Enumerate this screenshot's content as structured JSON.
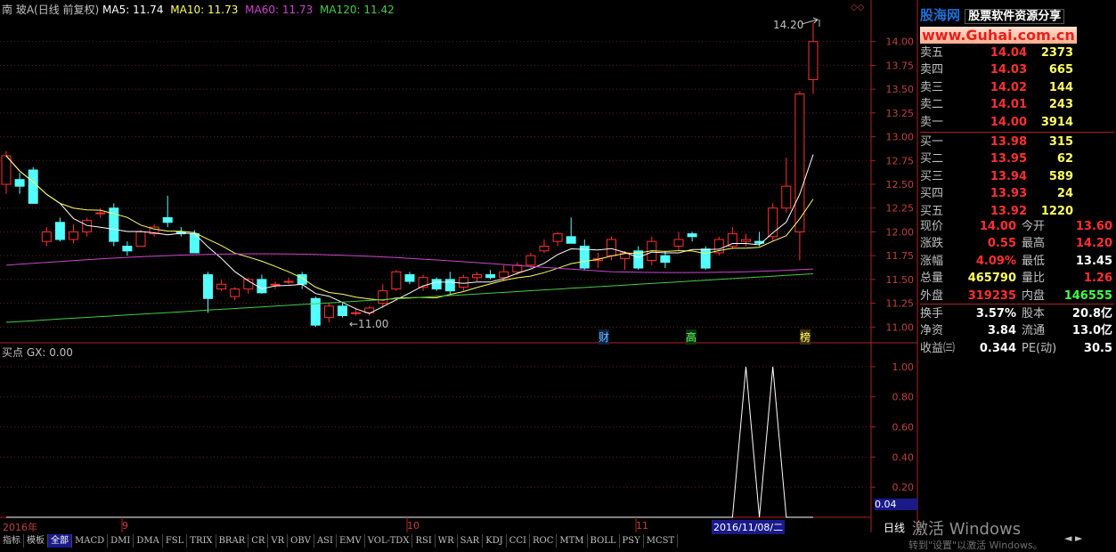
{
  "header": {
    "stock": "南 玻A",
    "mode": "(日线 前复权)",
    "ma5": "MA5: 11.74",
    "ma10": "MA10: 11.73",
    "ma60": "MA60: 11.73",
    "ma120": "MA120: 11.42",
    "ma5_color": "#ffffff",
    "ma10_color": "#ffff66",
    "ma60_color": "#cc44cc",
    "ma120_color": "#44cc44"
  },
  "price_axis": [
    "14.00",
    "13.75",
    "13.50",
    "13.25",
    "13.00",
    "12.75",
    "12.50",
    "12.25",
    "12.00",
    "11.75",
    "11.50",
    "11.25",
    "11.00"
  ],
  "annotations": {
    "high": "14.20",
    "low": "←11.00",
    "event1": "财",
    "event2": "高",
    "event3": "榜"
  },
  "indicator": {
    "title": "买点 GX: 0.00",
    "axis": [
      "1.00",
      "0.80",
      "0.60",
      "0.40",
      "0.20"
    ],
    "current": "0.04"
  },
  "time_axis": {
    "labels": [
      "2016年",
      "9",
      "10",
      "11"
    ],
    "cursor_date": "2016/11/08/二"
  },
  "watermark": {
    "logo": "股海网",
    "tagline": "股票软件资源分享",
    "url": "www.Guhai.com.cn"
  },
  "order_book": {
    "asks": [
      {
        "label": "卖五",
        "price": "14.04",
        "vol": "2373"
      },
      {
        "label": "卖四",
        "price": "14.03",
        "vol": "665"
      },
      {
        "label": "卖三",
        "price": "14.02",
        "vol": "144"
      },
      {
        "label": "卖二",
        "price": "14.01",
        "vol": "243"
      },
      {
        "label": "卖一",
        "price": "14.00",
        "vol": "3914"
      }
    ],
    "bids": [
      {
        "label": "买一",
        "price": "13.98",
        "vol": "315"
      },
      {
        "label": "买二",
        "price": "13.95",
        "vol": "62"
      },
      {
        "label": "买三",
        "price": "13.94",
        "vol": "589"
      },
      {
        "label": "买四",
        "price": "13.93",
        "vol": "24"
      },
      {
        "label": "买五",
        "price": "13.92",
        "vol": "1220"
      }
    ]
  },
  "quote": [
    {
      "l1": "现价",
      "v1": "14.00",
      "c1": "#ff3030",
      "l2": "今开",
      "v2": "13.60",
      "c2": "#ff3030"
    },
    {
      "l1": "涨跌",
      "v1": "0.55",
      "c1": "#ff3030",
      "l2": "最高",
      "v2": "14.20",
      "c2": "#ff3030"
    },
    {
      "l1": "涨幅",
      "v1": "4.09%",
      "c1": "#ff3030",
      "l2": "最低",
      "v2": "13.45",
      "c2": "#ffffff"
    },
    {
      "l1": "总量",
      "v1": "465790",
      "c1": "#ffff66",
      "l2": "量比",
      "v2": "1.26",
      "c2": "#ff3030"
    },
    {
      "l1": "外盘",
      "v1": "319235",
      "c1": "#ff3030",
      "l2": "内盘",
      "v2": "146555",
      "c2": "#44ff44"
    }
  ],
  "fundamentals": [
    {
      "l1": "换手",
      "v1": "3.57%",
      "l2": "股本",
      "v2": "20.8亿"
    },
    {
      "l1": "净资",
      "v1": "3.84",
      "l2": "流通",
      "v2": "13.0亿"
    },
    {
      "l1": "收益㈢",
      "v1": "0.344",
      "l2": "PE(动)",
      "v2": "30.5"
    }
  ],
  "period_label": "日线",
  "activate_overlay": "激活 Windows",
  "activate_sub": "转到\"设置\"以激活 Windows。",
  "tabs": [
    "指标",
    "模板",
    "全部",
    "MACD",
    "DMI",
    "DMA",
    "FSL",
    "TRIX",
    "BRAR",
    "CR",
    "VR",
    "OBV",
    "ASI",
    "EMV",
    "VOL-TDX",
    "RSI",
    "WR",
    "SAR",
    "KDJ",
    "CCI",
    "ROC",
    "MTM",
    "BOLL",
    "PSY",
    "MCST"
  ],
  "active_tab": "全部",
  "chart_data": {
    "type": "candlestick",
    "ylim": [
      10.9,
      14.25
    ],
    "candles": [
      {
        "o": 12.5,
        "h": 12.85,
        "l": 12.4,
        "c": 12.8
      },
      {
        "o": 12.55,
        "h": 12.62,
        "l": 12.4,
        "c": 12.48
      },
      {
        "o": 12.65,
        "h": 12.68,
        "l": 12.35,
        "c": 12.3
      },
      {
        "o": 11.9,
        "h": 12.05,
        "l": 11.85,
        "c": 12.0
      },
      {
        "o": 12.1,
        "h": 12.15,
        "l": 11.9,
        "c": 11.92
      },
      {
        "o": 11.92,
        "h": 12.08,
        "l": 11.88,
        "c": 12.0
      },
      {
        "o": 12.0,
        "h": 12.15,
        "l": 11.95,
        "c": 12.12
      },
      {
        "o": 12.2,
        "h": 12.25,
        "l": 12.15,
        "c": 12.2
      },
      {
        "o": 12.25,
        "h": 12.3,
        "l": 11.85,
        "c": 11.9
      },
      {
        "o": 11.85,
        "h": 11.9,
        "l": 11.75,
        "c": 11.8
      },
      {
        "o": 11.85,
        "h": 12.02,
        "l": 11.85,
        "c": 12.0
      },
      {
        "o": 11.98,
        "h": 12.08,
        "l": 11.95,
        "c": 12.05
      },
      {
        "o": 12.15,
        "h": 12.38,
        "l": 12.05,
        "c": 12.1
      },
      {
        "o": 12.0,
        "h": 12.05,
        "l": 11.95,
        "c": 11.98
      },
      {
        "o": 11.98,
        "h": 12.02,
        "l": 11.78,
        "c": 11.78
      },
      {
        "o": 11.55,
        "h": 11.58,
        "l": 11.15,
        "c": 11.3
      },
      {
        "o": 11.4,
        "h": 11.5,
        "l": 11.38,
        "c": 11.45
      },
      {
        "o": 11.32,
        "h": 11.42,
        "l": 11.28,
        "c": 11.4
      },
      {
        "o": 11.4,
        "h": 11.52,
        "l": 11.35,
        "c": 11.5
      },
      {
        "o": 11.5,
        "h": 11.55,
        "l": 11.35,
        "c": 11.36
      },
      {
        "o": 11.45,
        "h": 11.48,
        "l": 11.4,
        "c": 11.45
      },
      {
        "o": 11.48,
        "h": 11.52,
        "l": 11.45,
        "c": 11.48
      },
      {
        "o": 11.55,
        "h": 11.58,
        "l": 11.4,
        "c": 11.45
      },
      {
        "o": 11.3,
        "h": 11.32,
        "l": 11.0,
        "c": 11.02
      },
      {
        "o": 11.1,
        "h": 11.25,
        "l": 11.05,
        "c": 11.22
      },
      {
        "o": 11.22,
        "h": 11.25,
        "l": 11.1,
        "c": 11.12
      },
      {
        "o": 11.15,
        "h": 11.2,
        "l": 11.12,
        "c": 11.15
      },
      {
        "o": 11.15,
        "h": 11.22,
        "l": 11.12,
        "c": 11.2
      },
      {
        "o": 11.25,
        "h": 11.45,
        "l": 11.2,
        "c": 11.38
      },
      {
        "o": 11.4,
        "h": 11.6,
        "l": 11.38,
        "c": 11.58
      },
      {
        "o": 11.55,
        "h": 11.58,
        "l": 11.45,
        "c": 11.48
      },
      {
        "o": 11.42,
        "h": 11.55,
        "l": 11.38,
        "c": 11.52
      },
      {
        "o": 11.5,
        "h": 11.52,
        "l": 11.38,
        "c": 11.4
      },
      {
        "o": 11.5,
        "h": 11.58,
        "l": 11.35,
        "c": 11.38
      },
      {
        "o": 11.42,
        "h": 11.55,
        "l": 11.38,
        "c": 11.52
      },
      {
        "o": 11.52,
        "h": 11.58,
        "l": 11.48,
        "c": 11.55
      },
      {
        "o": 11.55,
        "h": 11.6,
        "l": 11.5,
        "c": 11.52
      },
      {
        "o": 11.52,
        "h": 11.65,
        "l": 11.48,
        "c": 11.58
      },
      {
        "o": 11.58,
        "h": 11.68,
        "l": 11.55,
        "c": 11.65
      },
      {
        "o": 11.65,
        "h": 11.78,
        "l": 11.62,
        "c": 11.75
      },
      {
        "o": 11.8,
        "h": 11.92,
        "l": 11.78,
        "c": 11.85
      },
      {
        "o": 11.9,
        "h": 12.0,
        "l": 11.85,
        "c": 11.98
      },
      {
        "o": 11.95,
        "h": 12.15,
        "l": 11.88,
        "c": 11.88
      },
      {
        "o": 11.85,
        "h": 11.92,
        "l": 11.6,
        "c": 11.62
      },
      {
        "o": 11.7,
        "h": 11.78,
        "l": 11.62,
        "c": 11.72
      },
      {
        "o": 11.75,
        "h": 11.95,
        "l": 11.7,
        "c": 11.92
      },
      {
        "o": 11.72,
        "h": 11.8,
        "l": 11.6,
        "c": 11.78
      },
      {
        "o": 11.8,
        "h": 11.85,
        "l": 11.6,
        "c": 11.62
      },
      {
        "o": 11.7,
        "h": 11.95,
        "l": 11.65,
        "c": 11.9
      },
      {
        "o": 11.75,
        "h": 11.8,
        "l": 11.62,
        "c": 11.68
      },
      {
        "o": 11.85,
        "h": 12.0,
        "l": 11.8,
        "c": 11.92
      },
      {
        "o": 11.98,
        "h": 12.0,
        "l": 11.9,
        "c": 11.95
      },
      {
        "o": 11.82,
        "h": 11.85,
        "l": 11.6,
        "c": 11.62
      },
      {
        "o": 11.78,
        "h": 11.95,
        "l": 11.75,
        "c": 11.92
      },
      {
        "o": 11.85,
        "h": 12.05,
        "l": 11.82,
        "c": 11.98
      },
      {
        "o": 11.9,
        "h": 11.98,
        "l": 11.85,
        "c": 11.92
      },
      {
        "o": 11.9,
        "h": 12.0,
        "l": 11.85,
        "c": 11.88
      },
      {
        "o": 11.95,
        "h": 12.3,
        "l": 11.9,
        "c": 12.25
      },
      {
        "o": 12.25,
        "h": 12.78,
        "l": 12.2,
        "c": 12.48
      },
      {
        "o": 12.0,
        "h": 13.48,
        "l": 11.7,
        "c": 13.45
      },
      {
        "o": 13.6,
        "h": 14.2,
        "l": 13.45,
        "c": 14.0
      }
    ],
    "gx_signal": [
      0,
      0,
      0,
      0,
      0,
      0,
      0,
      0,
      0,
      0,
      0,
      0,
      0,
      0,
      0,
      0,
      0,
      0,
      0,
      0,
      0,
      0,
      0,
      0,
      0,
      0,
      0,
      0,
      0,
      0,
      0,
      0,
      0,
      0,
      0,
      0,
      0,
      0,
      0,
      0,
      0,
      0,
      0,
      0,
      0,
      0,
      0,
      0,
      0,
      0,
      0,
      0,
      0,
      0,
      0,
      1,
      0,
      1,
      0,
      0,
      0
    ],
    "gx_ylim": [
      0,
      1.1
    ]
  }
}
